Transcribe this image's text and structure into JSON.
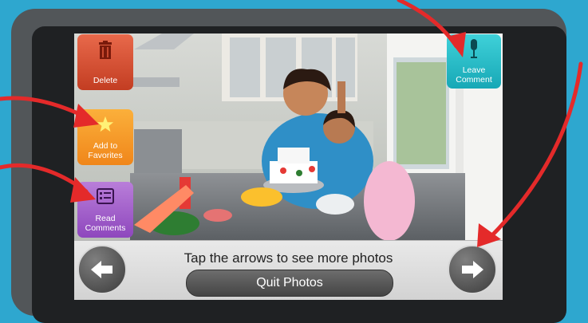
{
  "screen": {
    "hint_text": "Tap the arrows to see more photos",
    "quit_label": "Quit Photos"
  },
  "side_buttons": {
    "delete": {
      "label": "Delete",
      "icon": "trash-icon"
    },
    "favorites": {
      "label_line1": "Add to",
      "label_line2": "Favorites",
      "icon": "star-icon"
    },
    "read": {
      "label_line1": "Read",
      "label_line2": "Comments",
      "icon": "list-icon"
    },
    "comment": {
      "label_line1": "Leave",
      "label_line2": "Comment",
      "icon": "microphone-icon"
    }
  },
  "nav": {
    "prev_icon": "left-arrow-icon",
    "next_icon": "right-arrow-icon"
  },
  "colors": {
    "background": "#2ea7cf",
    "delete": "#d8502f",
    "favorites": "#f7a12b",
    "read": "#a864cf",
    "comment": "#2cc0ca",
    "annotation_arrows": "#e42a2a"
  }
}
